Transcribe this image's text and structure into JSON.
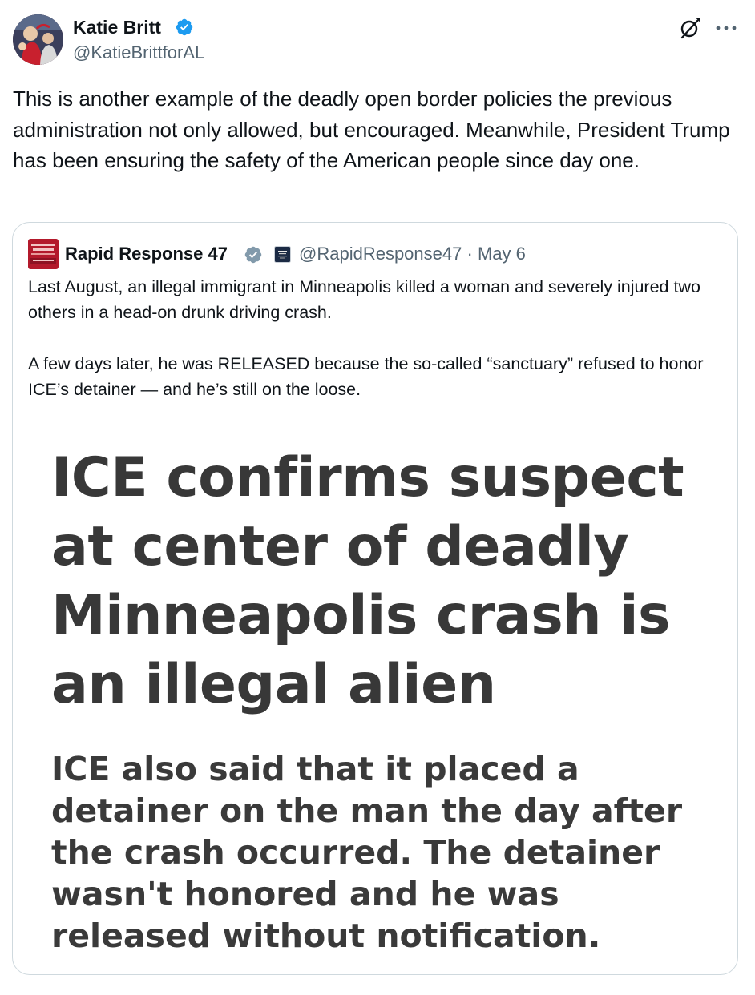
{
  "tweet": {
    "author_name": "Katie Britt",
    "author_handle": "@KatieBrittforAL",
    "text": "This is another example of the deadly open border policies the previous administration not only allowed, but encouraged. Meanwhile, President Trump has been ensuring the safety of the American people since day one.",
    "icons": [
      "verified-badge-icon",
      "grok-icon",
      "more-options-icon"
    ]
  },
  "quote": {
    "author_name": "Rapid Response 47",
    "author_handle": "@RapidResponse47",
    "separator": "·",
    "date": "May 6",
    "paragraphs": [
      "Last August, an illegal immigrant in Minneapolis killed a woman and severely injured two others in a head-on drunk driving crash.",
      "A few days later, he was RELEASED because the so-called “sanctuary” refused to honor ICE’s detainer — and he’s still on the loose."
    ],
    "image": {
      "headline": "ICE confirms suspect at center of deadly Minneapolis crash is an illegal alien",
      "subhead": "ICE also said that it placed a detainer on the man the day after the crash occurred. The detainer wasn't honored and he was released without notification."
    }
  },
  "colors": {
    "text_primary": "#0f1419",
    "text_secondary": "#536471",
    "verified_blue": "#1d9bf0",
    "card_border": "#cfd9de",
    "headline_gray": "#383838",
    "gov_badge_gray": "#829aab"
  }
}
